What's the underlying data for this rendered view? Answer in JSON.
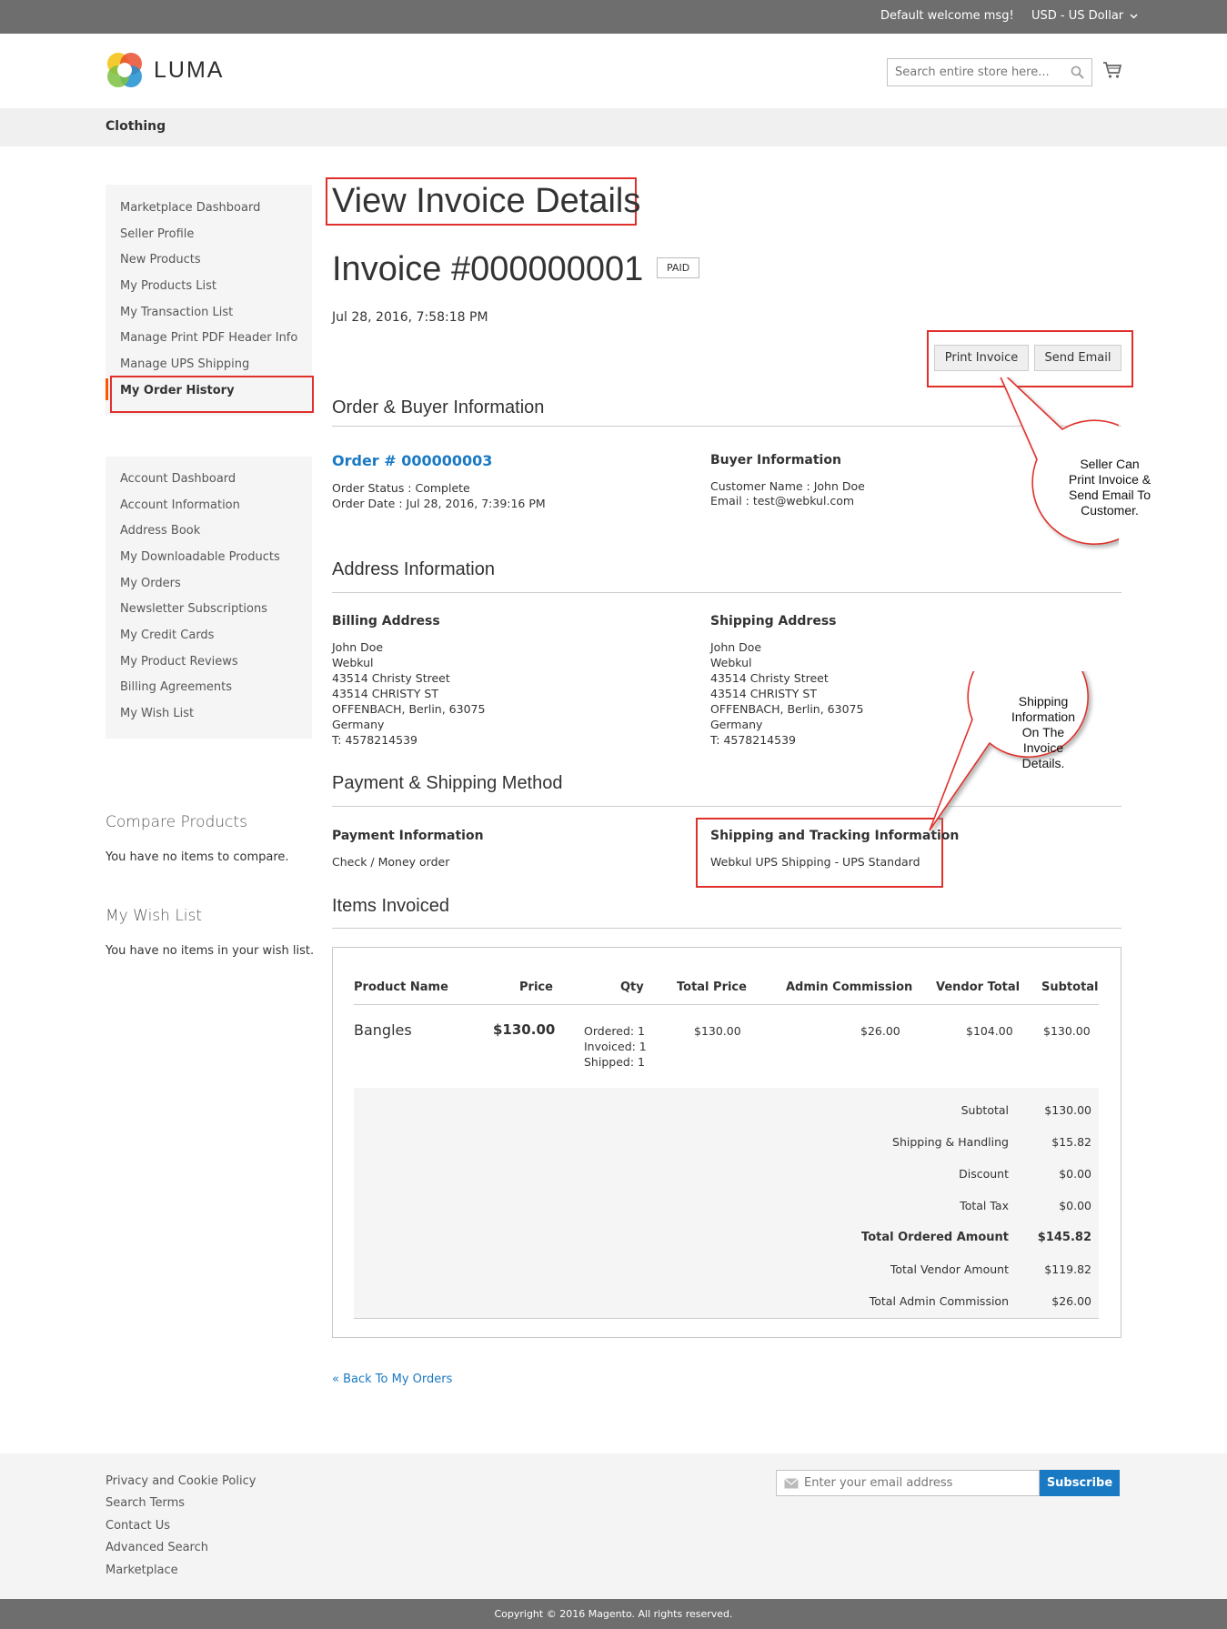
{
  "topbar": {
    "welcome": "Default welcome msg!",
    "currency": "USD - US Dollar"
  },
  "header": {
    "logo_text": "LUMA",
    "search_placeholder": "Search entire store here..."
  },
  "nav": {
    "items": [
      "Clothing"
    ]
  },
  "sidebar": {
    "marketplace_links": [
      "Marketplace Dashboard",
      "Seller Profile",
      "New Products",
      "My Products List",
      "My Transaction List",
      "Manage Print PDF Header Info",
      "Manage UPS Shipping",
      "My Order History"
    ],
    "account_links": [
      "Account Dashboard",
      "Account Information",
      "Address Book",
      "My Downloadable Products",
      "My Orders",
      "Newsletter Subscriptions",
      "My Credit Cards",
      "My Product Reviews",
      "Billing Agreements",
      "My Wish List"
    ],
    "compare": {
      "title": "Compare Products",
      "empty": "You have no items to compare."
    },
    "wishlist": {
      "title": "My Wish List",
      "empty": "You have no items in your wish list."
    }
  },
  "main": {
    "page_title": "View Invoice Details",
    "invoice_title": "Invoice #000000001",
    "status_badge": "PAID",
    "date": "Jul 28, 2016, 7:58:18 PM",
    "buttons": {
      "print": "Print Invoice",
      "email": "Send Email"
    },
    "sections": {
      "order_buyer": "Order & Buyer Information",
      "address": "Address Information",
      "payment_shipping": "Payment & Shipping Method",
      "items": "Items Invoiced"
    },
    "order": {
      "link": "Order # 000000003",
      "status": "Order Status : Complete",
      "date": "Order Date : Jul 28, 2016, 7:39:16 PM"
    },
    "buyer": {
      "title": "Buyer Information",
      "name": "Customer Name : John Doe",
      "email": "Email : test@webkul.com"
    },
    "billing": {
      "title": "Billing Address",
      "lines": [
        "John Doe",
        "Webkul",
        "43514 Christy Street",
        "43514 CHRISTY ST",
        "OFFENBACH, Berlin, 63075",
        "Germany",
        "T: 4578214539"
      ]
    },
    "shipping": {
      "title": "Shipping Address",
      "lines": [
        "John Doe",
        "Webkul",
        "43514 Christy Street",
        "43514 CHRISTY ST",
        "OFFENBACH, Berlin, 63075",
        "Germany",
        "T: 4578214539"
      ]
    },
    "payment": {
      "title": "Payment Information",
      "value": "Check / Money order"
    },
    "tracking": {
      "title": "Shipping and Tracking Information",
      "value": "Webkul UPS Shipping - UPS Standard"
    },
    "table": {
      "headers": [
        "Product Name",
        "Price",
        "Qty",
        "Total Price",
        "Admin Commission",
        "Vendor Total",
        "Subtotal"
      ],
      "row": {
        "name": "Bangles",
        "price": "$130.00",
        "qty": [
          "Ordered: 1",
          "Invoiced: 1",
          "Shipped: 1"
        ],
        "total_price": "$130.00",
        "admin_commission": "$26.00",
        "vendor_total": "$104.00",
        "subtotal": "$130.00"
      },
      "totals": [
        {
          "label": "Subtotal",
          "value": "$130.00"
        },
        {
          "label": "Shipping & Handling",
          "value": "$15.82"
        },
        {
          "label": "Discount",
          "value": "$0.00"
        },
        {
          "label": "Total Tax",
          "value": "$0.00"
        },
        {
          "label": "Total Ordered Amount",
          "value": "$145.82"
        },
        {
          "label": "Total Vendor Amount",
          "value": "$119.82"
        },
        {
          "label": "Total Admin Commission",
          "value": "$26.00"
        }
      ]
    },
    "back_link": "« Back To My Orders"
  },
  "callouts": {
    "print_email": [
      "Seller Can",
      "Print Invoice &",
      "Send Email To",
      "Customer."
    ],
    "shipping_info": [
      "Shipping",
      "Information",
      "On The",
      "Invoice",
      "Details."
    ]
  },
  "footer": {
    "links": [
      "Privacy and Cookie Policy",
      "Search Terms",
      "Contact Us",
      "Advanced Search",
      "Marketplace"
    ],
    "newsletter_placeholder": "Enter your email address",
    "subscribe": "Subscribe",
    "copyright": "Copyright © 2016 Magento. All rights reserved."
  },
  "colors": {
    "accent": "#1979c3",
    "annotation": "#e0302c",
    "topbar": "#6e6e6e"
  },
  "icons": [
    "luma-logo-icon",
    "search-icon",
    "cart-icon",
    "chevron-down-icon",
    "mail-icon"
  ]
}
